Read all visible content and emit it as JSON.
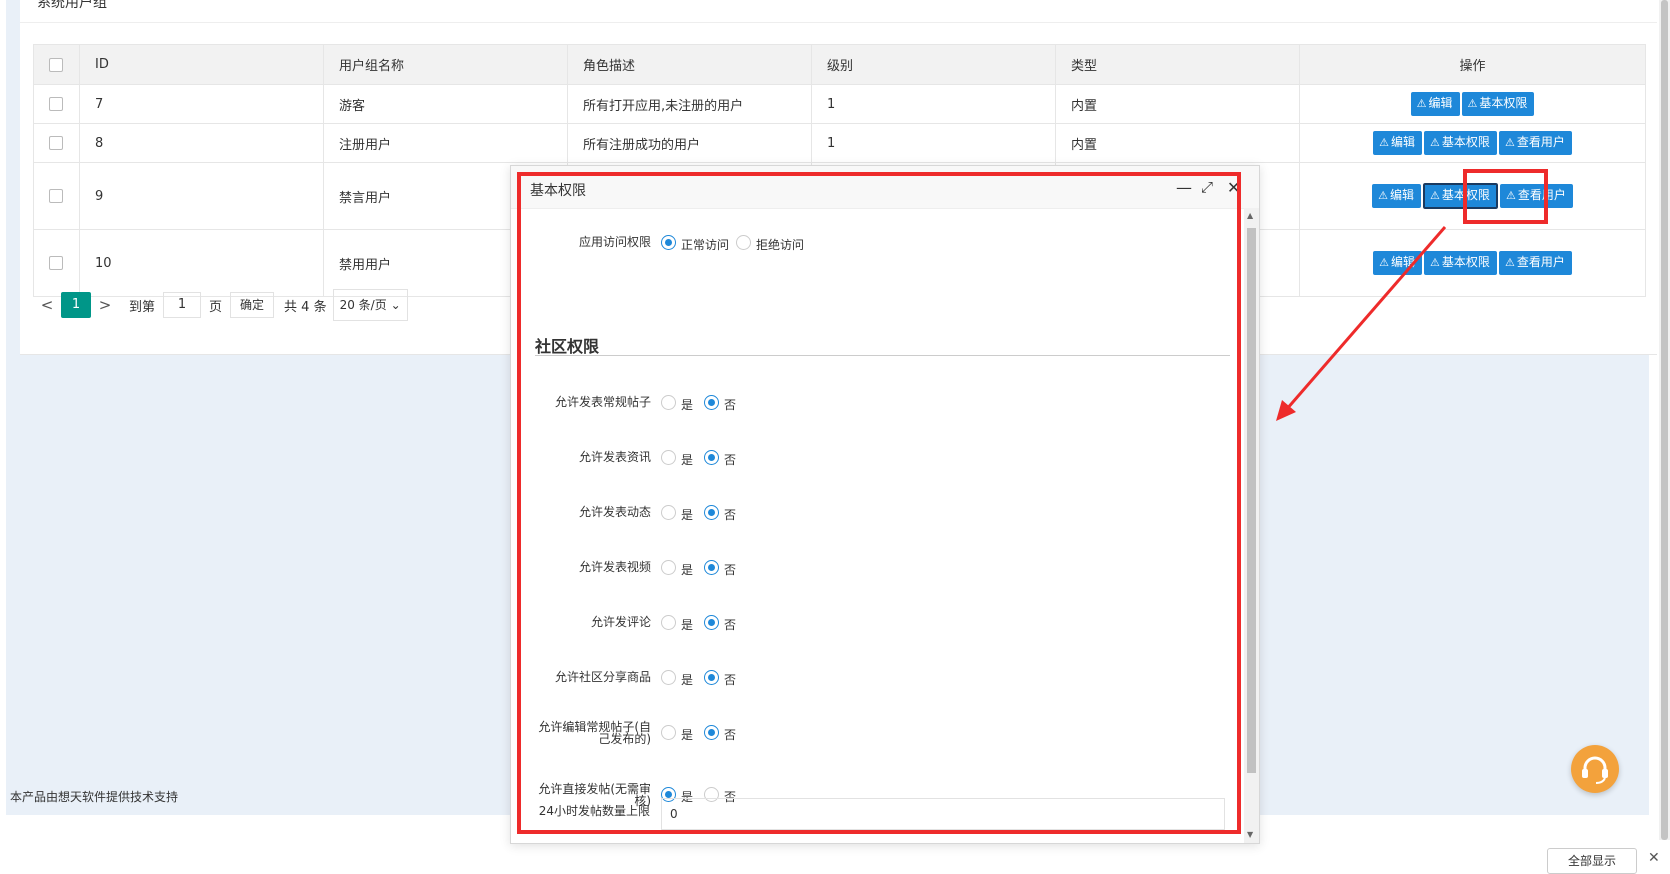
{
  "card": {
    "title": "系统用户组"
  },
  "table": {
    "headers": [
      "ID",
      "用户组名称",
      "角色描述",
      "级别",
      "类型",
      "操作"
    ],
    "rows": [
      {
        "id": "7",
        "name": "游客",
        "desc": "所有打开应用,未注册的用户",
        "level": "1",
        "type": "内置",
        "ops": [
          "编辑",
          "基本权限"
        ]
      },
      {
        "id": "8",
        "name": "注册用户",
        "desc": "所有注册成功的用户",
        "level": "1",
        "type": "内置",
        "ops": [
          "编辑",
          "基本权限",
          "查看用户"
        ]
      },
      {
        "id": "9",
        "name": "禁言用户",
        "desc": "",
        "level": "",
        "type": "",
        "ops": [
          "编辑",
          "基本权限",
          "查看用户"
        ]
      },
      {
        "id": "10",
        "name": "禁用用户",
        "desc": "",
        "level": "",
        "type": "",
        "ops": [
          "编辑",
          "基本权限",
          "查看用户"
        ]
      }
    ],
    "warn_icon": "⚠"
  },
  "pager": {
    "prev": "<",
    "current": "1",
    "next": ">",
    "goto_label": "到第",
    "page_input": "1",
    "page_suffix": "页",
    "confirm": "确定",
    "total": "共 4 条",
    "page_size": "20 条/页"
  },
  "footer": {
    "text": "本产品由想天软件提供技术支持",
    "bottom_button": "全部显示"
  },
  "modal": {
    "title": "基本权限",
    "access": {
      "label": "应用访问权限",
      "options": [
        "正常访问",
        "拒绝访问"
      ],
      "selected": 0
    },
    "section_title": "社区权限",
    "permissions": [
      {
        "label": "允许发表常规帖子",
        "yes": "是",
        "no": "否",
        "selected": "no"
      },
      {
        "label": "允许发表资讯",
        "yes": "是",
        "no": "否",
        "selected": "no"
      },
      {
        "label": "允许发表动态",
        "yes": "是",
        "no": "否",
        "selected": "no"
      },
      {
        "label": "允许发表视频",
        "yes": "是",
        "no": "否",
        "selected": "no"
      },
      {
        "label": "允许发评论",
        "yes": "是",
        "no": "否",
        "selected": "no"
      },
      {
        "label": "允许社区分享商品",
        "yes": "是",
        "no": "否",
        "selected": "no"
      },
      {
        "label_line1": "允许编辑常规帖子(自",
        "label_line2": "己发布的)",
        "yes": "是",
        "no": "否",
        "selected": "no"
      },
      {
        "label_line1": "允许直接发帖(无需审",
        "label_line2": "核)",
        "yes": "是",
        "no": "否",
        "selected": "yes"
      }
    ],
    "daily_limit": {
      "label": "24小时发帖数量上限",
      "value": "0"
    }
  },
  "colors": {
    "primary_button": "#1e88d9",
    "pager_active": "#009688",
    "highlight": "#ee2b2b",
    "support_icon": "#f3a23c"
  }
}
